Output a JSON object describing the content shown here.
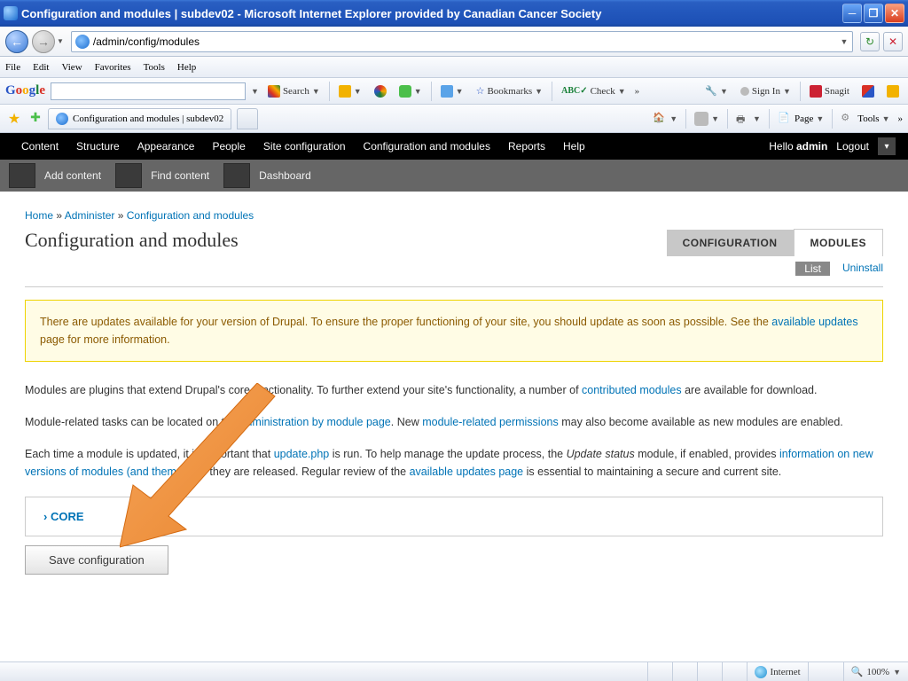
{
  "window": {
    "title": "Configuration and modules | subdev02 - Microsoft Internet Explorer provided by Canadian Cancer Society"
  },
  "address": "/admin/config/modules",
  "menus": [
    "File",
    "Edit",
    "View",
    "Favorites",
    "Tools",
    "Help"
  ],
  "google_toolbar": {
    "search_label": "Search",
    "bookmarks_label": "Bookmarks",
    "check_label": "Check",
    "signin_label": "Sign In",
    "snagit_label": "Snagit"
  },
  "browser_tab": {
    "label": "Configuration and modules | subdev02"
  },
  "command_bar": {
    "page_label": "Page",
    "tools_label": "Tools"
  },
  "admin_menu": {
    "items": [
      "Content",
      "Structure",
      "Appearance",
      "People",
      "Site configuration",
      "Configuration and modules",
      "Reports",
      "Help"
    ],
    "hello": "Hello ",
    "user": "admin",
    "logout": "Logout"
  },
  "shortcuts": [
    "Add content",
    "Find content",
    "Dashboard"
  ],
  "breadcrumb": {
    "home": "Home",
    "admin": "Administer",
    "current": "Configuration and modules",
    "sep": " » "
  },
  "page_title": "Configuration and modules",
  "tabs": {
    "config": "CONFIGURATION",
    "modules": "MODULES"
  },
  "subtabs": {
    "list": "List",
    "uninstall": "Uninstall"
  },
  "warning": {
    "t1": "There are updates available for your version of Drupal. To ensure the proper functioning of your site, you should update as soon as possible. See the ",
    "link": "available updates",
    "t2": " page for more information."
  },
  "para1": {
    "t1": "Modules are plugins that extend Drupal's core functionality. To further extend your site's functionality, a number of ",
    "link1": "contributed modules",
    "t2": " are available for download."
  },
  "para2": {
    "t1": "Module-related tasks can be located on the ",
    "link1": "administration by module page",
    "t2": ". New ",
    "link2": "module-related permissions",
    "t3": " may also become available as new modules are enabled."
  },
  "para3": {
    "t1": "Each time a module is updated, it is important that ",
    "link1": "update.php",
    "t2": " is run. To help manage the update process, the ",
    "em1": "Update status",
    "t3": " module, if enabled, provides ",
    "link2": "information on new versions of modules (and themes)",
    "t4": " as they are released. Regular review of the ",
    "link3": "available updates page",
    "t5": " is essential to maintaining a secure and current site."
  },
  "fieldset_core": "CORE",
  "save_button": "Save configuration",
  "status": {
    "zone": "Internet",
    "zoom": "100%"
  }
}
